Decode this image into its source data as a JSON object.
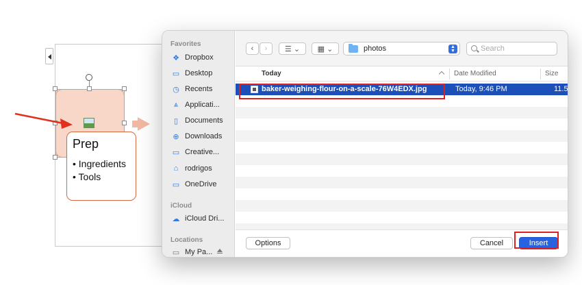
{
  "slide": {
    "title": "Prep",
    "bullets": [
      "• Ingredients",
      "• Tools"
    ]
  },
  "dialog": {
    "sidebar": {
      "sections": [
        {
          "header": "Favorites",
          "items": [
            {
              "label": "Dropbox",
              "icon": "dropbox-icon"
            },
            {
              "label": "Desktop",
              "icon": "desktop-icon"
            },
            {
              "label": "Recents",
              "icon": "clock-icon"
            },
            {
              "label": "Applicati...",
              "icon": "applications-icon"
            },
            {
              "label": "Documents",
              "icon": "document-icon"
            },
            {
              "label": "Downloads",
              "icon": "download-icon"
            },
            {
              "label": "Creative...",
              "icon": "folder-icon"
            },
            {
              "label": "rodrigos",
              "icon": "home-icon"
            },
            {
              "label": "OneDrive",
              "icon": "folder-icon"
            }
          ]
        },
        {
          "header": "iCloud",
          "items": [
            {
              "label": "iCloud Dri...",
              "icon": "cloud-icon"
            }
          ]
        },
        {
          "header": "Locations",
          "items": [
            {
              "label": "My Pa...",
              "icon": "drive-icon"
            }
          ]
        }
      ]
    },
    "toolbar": {
      "current_folder": "photos",
      "search_placeholder": "Search"
    },
    "columns": {
      "name": "Today",
      "date_modified": "Date Modified",
      "size": "Size"
    },
    "selected_file": {
      "name": "baker-weighing-flour-on-a-scale-76W4EDX.jpg",
      "date_modified": "Today, 9:46 PM",
      "size": "11.5"
    },
    "buttons": {
      "options": "Options",
      "cancel": "Cancel",
      "insert": "Insert"
    },
    "colors": {
      "selection": "#1d4fb8",
      "primary_button": "#2763e0",
      "highlight": "#e02020"
    }
  }
}
